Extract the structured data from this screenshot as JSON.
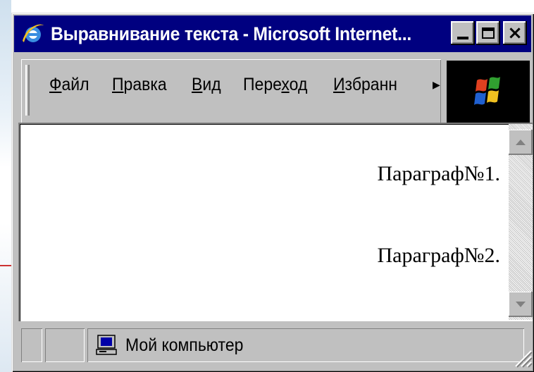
{
  "window": {
    "title": "Выравнивание текста - Microsoft Internet..."
  },
  "caption_buttons": {
    "minimize": "minimize",
    "maximize": "maximize",
    "close": "×"
  },
  "menu": {
    "items": [
      {
        "underlined": "Ф",
        "rest": "айл"
      },
      {
        "underlined": "П",
        "rest": "равка"
      },
      {
        "underlined": "В",
        "rest": "ид"
      },
      {
        "pre": "Пере",
        "underlined": "х",
        "rest": "од"
      },
      {
        "underlined": "И",
        "rest": "збранн"
      }
    ],
    "overflow_icon": "chevron-right-icon"
  },
  "content": {
    "paragraphs": [
      "Параграф№1.",
      "Параграф№2."
    ]
  },
  "status": {
    "zone_label": "Мой компьютер",
    "zone_icon": "my-computer-icon"
  },
  "colors": {
    "titlebar": "#000080",
    "chrome": "#c0c0c0",
    "content_bg": "#ffffff"
  }
}
